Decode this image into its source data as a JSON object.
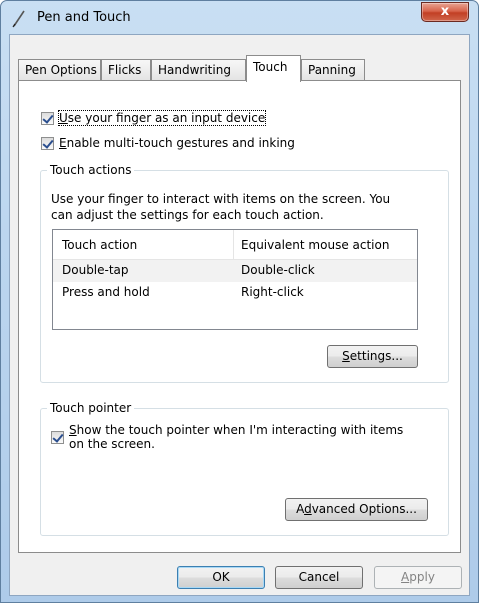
{
  "window": {
    "title": "Pen and Touch",
    "close_label": "x"
  },
  "tabs": [
    {
      "label": "Pen Options"
    },
    {
      "label": "Flicks"
    },
    {
      "label": "Handwriting"
    },
    {
      "label": "Touch"
    },
    {
      "label": "Panning"
    }
  ],
  "active_tab": "Touch",
  "options": {
    "finger_input": {
      "before": "",
      "accel": "U",
      "after": "se your finger as an input device",
      "checked": true
    },
    "multitouch": {
      "before": "",
      "accel": "E",
      "after": "nable multi-touch gestures and inking",
      "checked": true
    }
  },
  "touch_actions": {
    "group_title": "Touch actions",
    "description_line1": "Use your finger to interact with items on the screen. You",
    "description_line2": "can adjust the settings for each touch action.",
    "columns": [
      "Touch action",
      "Equivalent mouse action"
    ],
    "rows": [
      {
        "action": "Double-tap",
        "mouse": "Double-click"
      },
      {
        "action": "Press and hold",
        "mouse": "Right-click"
      }
    ],
    "settings_accel": "S",
    "settings_rest": "ettings..."
  },
  "touch_pointer": {
    "group_title": "Touch pointer",
    "show_line1_accel": "S",
    "show_line1_rest": "how the touch pointer when I'm interacting with items",
    "show_line2": "on the screen.",
    "checked": true,
    "advanced_before": "A",
    "advanced_accel": "d",
    "advanced_after": "vanced Options..."
  },
  "footer": {
    "ok": "OK",
    "cancel": "Cancel",
    "apply_accel": "A",
    "apply_rest": "pply"
  }
}
